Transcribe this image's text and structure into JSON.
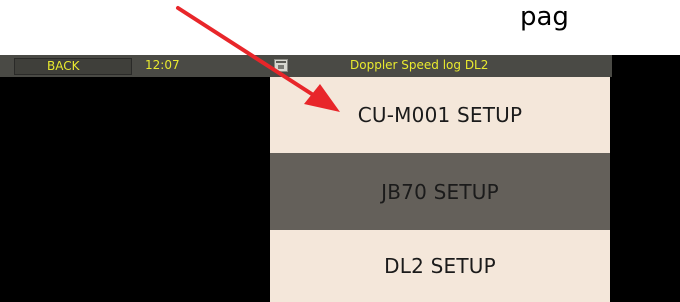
{
  "caption": {
    "fragment": "pag"
  },
  "statusbar": {
    "back_label": "BACK",
    "clock": "12:07",
    "title": "Doppler Speed log DL2"
  },
  "menu": {
    "items": [
      {
        "label": "CU-M001 SETUP"
      },
      {
        "label": "JB70 SETUP"
      },
      {
        "label": "DL2 SETUP"
      }
    ]
  },
  "colors": {
    "status_text": "#e9ea2f",
    "menu_light": "#f4e7da",
    "menu_selected": "#64605a",
    "annotation_arrow": "#e8262a"
  },
  "icons": {
    "window_icon": "app-window-icon",
    "arrow": "annotation-arrow"
  }
}
